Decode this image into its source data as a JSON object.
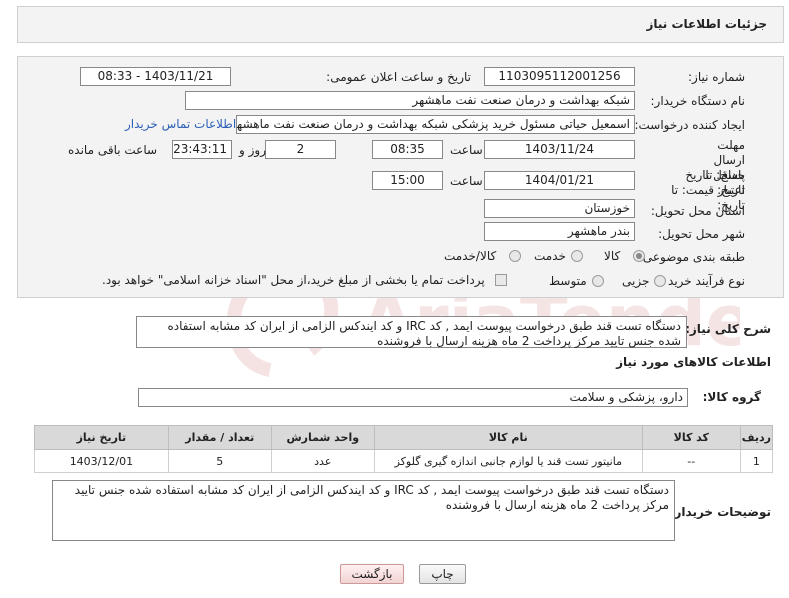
{
  "header": {
    "title": "جزئیات اطلاعات نیاز"
  },
  "form": {
    "need_number": {
      "label": "شماره نیاز:",
      "value": "1103095112001256"
    },
    "announce": {
      "label": "تاریخ و ساعت اعلان عمومی:",
      "value": "1403/11/21 - 08:33"
    },
    "buyer_org": {
      "label": "نام دستگاه خریدار:",
      "value": "شبکه بهداشت و درمان صنعت نفت ماهشهر"
    },
    "creator": {
      "label": "ایجاد کننده درخواست:",
      "value": "اسمعیل حیاتی مسئول خرید پزشکی شبکه بهداشت و درمان صنعت نفت ماهشهر",
      "contact_link": "اطلاعات تماس خریدار"
    },
    "reply_deadline": {
      "label": "مهلت ارسال پاسخ: تا تاریخ:",
      "date": "1403/11/24",
      "time_label": "ساعت",
      "time": "08:35",
      "days": "2",
      "days_label": "روز و",
      "remaining": "23:43:11",
      "remaining_label": "ساعت باقی مانده"
    },
    "price_validity": {
      "label": "حداقل تاریخ اعتبار قیمت: تا تاریخ:",
      "date": "1404/01/21",
      "time_label": "ساعت",
      "time": "15:00"
    },
    "province": {
      "label": "استان محل تحویل:",
      "value": "خوزستان"
    },
    "city": {
      "label": "شهر محل تحویل:",
      "value": "بندر ماهشهر"
    },
    "category": {
      "label": "طبقه بندی موضوعی:",
      "options": [
        "کالا",
        "خدمت",
        "کالا/خدمت"
      ],
      "selected": "کالا"
    },
    "purchase_type": {
      "label": "نوع فرآیند خرید :",
      "options": [
        "جزیی",
        "متوسط"
      ],
      "note": "پرداخت تمام یا بخشی از مبلغ خرید،از محل \"اسناد خزانه اسلامی\" خواهد بود."
    }
  },
  "summary": {
    "label": "شرح کلی نیاز:",
    "text": "دستگاه تست قند طبق درخواست پیوست ایمد , کد IRC و کد ایندکس الزامی از ایران کد مشابه استفاده شده جنس تایید مرکز پرداخت 2 ماه هزینه ارسال با فروشنده"
  },
  "goods_info": {
    "title": "اطلاعات کالاهای مورد نیاز",
    "group_label": "گروه کالا:",
    "group_value": "دارو، پزشکی و سلامت",
    "columns": [
      "ردیف",
      "کد کالا",
      "نام کالا",
      "واحد شمارش",
      "تعداد / مقدار",
      "تاریخ نیاز"
    ],
    "rows": [
      [
        "1",
        "--",
        "مانیتور تست قند یا لوازم جانبی اندازه گیری گلوکز",
        "عدد",
        "5",
        "1403/12/01"
      ]
    ]
  },
  "buyer_notes": {
    "label": "توضیحات خریدار:",
    "text": "دستگاه تست قند طبق درخواست پیوست ایمد , کد IRC و کد ایندکس الزامی از ایران کد مشابه استفاده شده جنس تایید مرکز پرداخت 2 ماه هزینه ارسال با فروشنده"
  },
  "buttons": {
    "print": "چاپ",
    "back": "بازگشت"
  },
  "colors": {
    "link": "#2d5fb7",
    "panel_bg": "#f3f3f3",
    "table_header": "#d9d9d9",
    "watermark": "#e7b6b6"
  }
}
